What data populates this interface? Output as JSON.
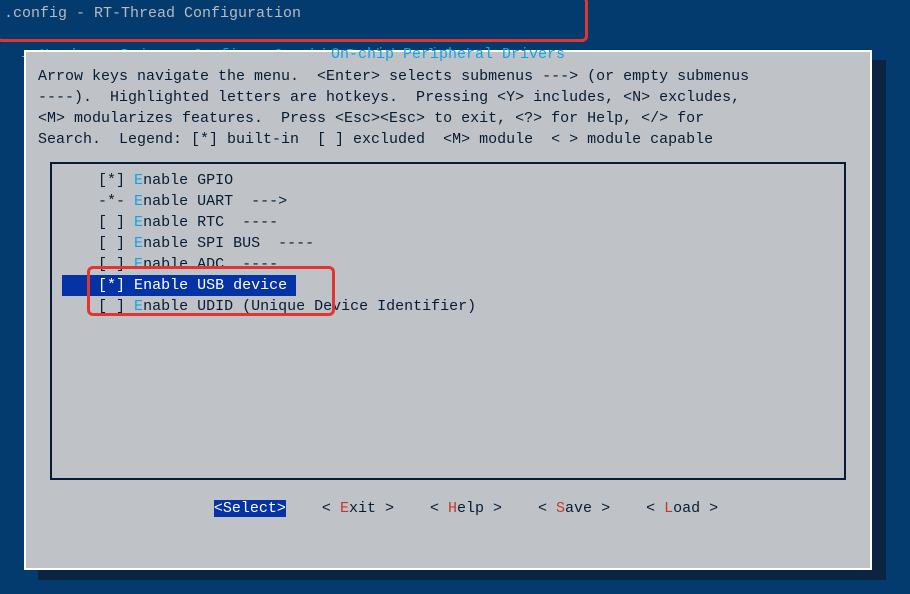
{
  "topbar": ".config - RT-Thread Configuration",
  "breadcrumb": {
    "arrow": "→",
    "seg1": "Hardware Drivers Config",
    "seg2": "On-chip Peripheral Drivers",
    "trail": "─"
  },
  "panel_title": "On-chip Peripheral Drivers",
  "help": {
    "l1": "Arrow keys navigate the menu.  <Enter> selects submenus ---> (or empty submenus",
    "l2": "----).  Highlighted letters are hotkeys.  Pressing <Y> includes, <N> excludes,",
    "l3": "<M> modularizes features.  Press <Esc><Esc> to exit, <?> for Help, </> for",
    "l4": "Search.  Legend: [*] built-in  [ ] excluded  <M> module  < > module capable"
  },
  "items": [
    {
      "mark": "[*]",
      "hk": "E",
      "rest": "nable GPIO",
      "suffix": ""
    },
    {
      "mark": "-*-",
      "hk": "E",
      "rest": "nable UART  --->",
      "suffix": ""
    },
    {
      "mark": "[ ]",
      "hk": "E",
      "rest": "nable RTC  ----",
      "suffix": ""
    },
    {
      "mark": "[ ]",
      "hk": "E",
      "rest": "nable SPI BUS  ----",
      "suffix": ""
    },
    {
      "mark": "[ ]",
      "hk": "E",
      "rest": "nable ADC  ----",
      "suffix": ""
    },
    {
      "mark": "[*]",
      "hk": "E",
      "rest": "nable USB device",
      "suffix": ""
    },
    {
      "mark": "[ ]",
      "hk": "E",
      "rest": "nable UDID (Unique Device Identifier)",
      "suffix": ""
    }
  ],
  "selected_index": 5,
  "buttons": {
    "select": "Select",
    "exit": "Exit",
    "help": "Help",
    "save": "Save",
    "load": "Load"
  }
}
